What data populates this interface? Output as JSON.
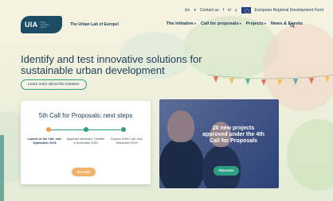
{
  "topbar": {
    "language": "En",
    "contact": "Contact us",
    "social": [
      "f",
      "in",
      "y"
    ],
    "eu_label": "European Regional Development Fund"
  },
  "header": {
    "logo_text": "UIA",
    "logo_sub": "Urban Innovative Actions",
    "tagline": "The Urban Lab of Europe!",
    "nav": [
      "The Initiative",
      "Call for proposals",
      "Projects",
      "News & Events"
    ]
  },
  "hero": {
    "headline": "Identify and test innovative solutions for sustainable urban development",
    "learn_more": "Learn more about the initiative"
  },
  "card_left": {
    "title": "5th Call for Proposals: next steps",
    "steps": [
      "Launch of the Call: mid-September 2019",
      "Applicant seminars: October & November 2019",
      "Closure of the Call: mid-December 2019"
    ],
    "button": "All news"
  },
  "card_right": {
    "caption": "20 new projects approved under the 4th Call for Proposals",
    "button": "Discover"
  },
  "colors": {
    "primary": "#20405a",
    "accent_green": "#2d9e84",
    "accent_orange": "#f1b26a",
    "logo_bg": "#1c4d64"
  }
}
